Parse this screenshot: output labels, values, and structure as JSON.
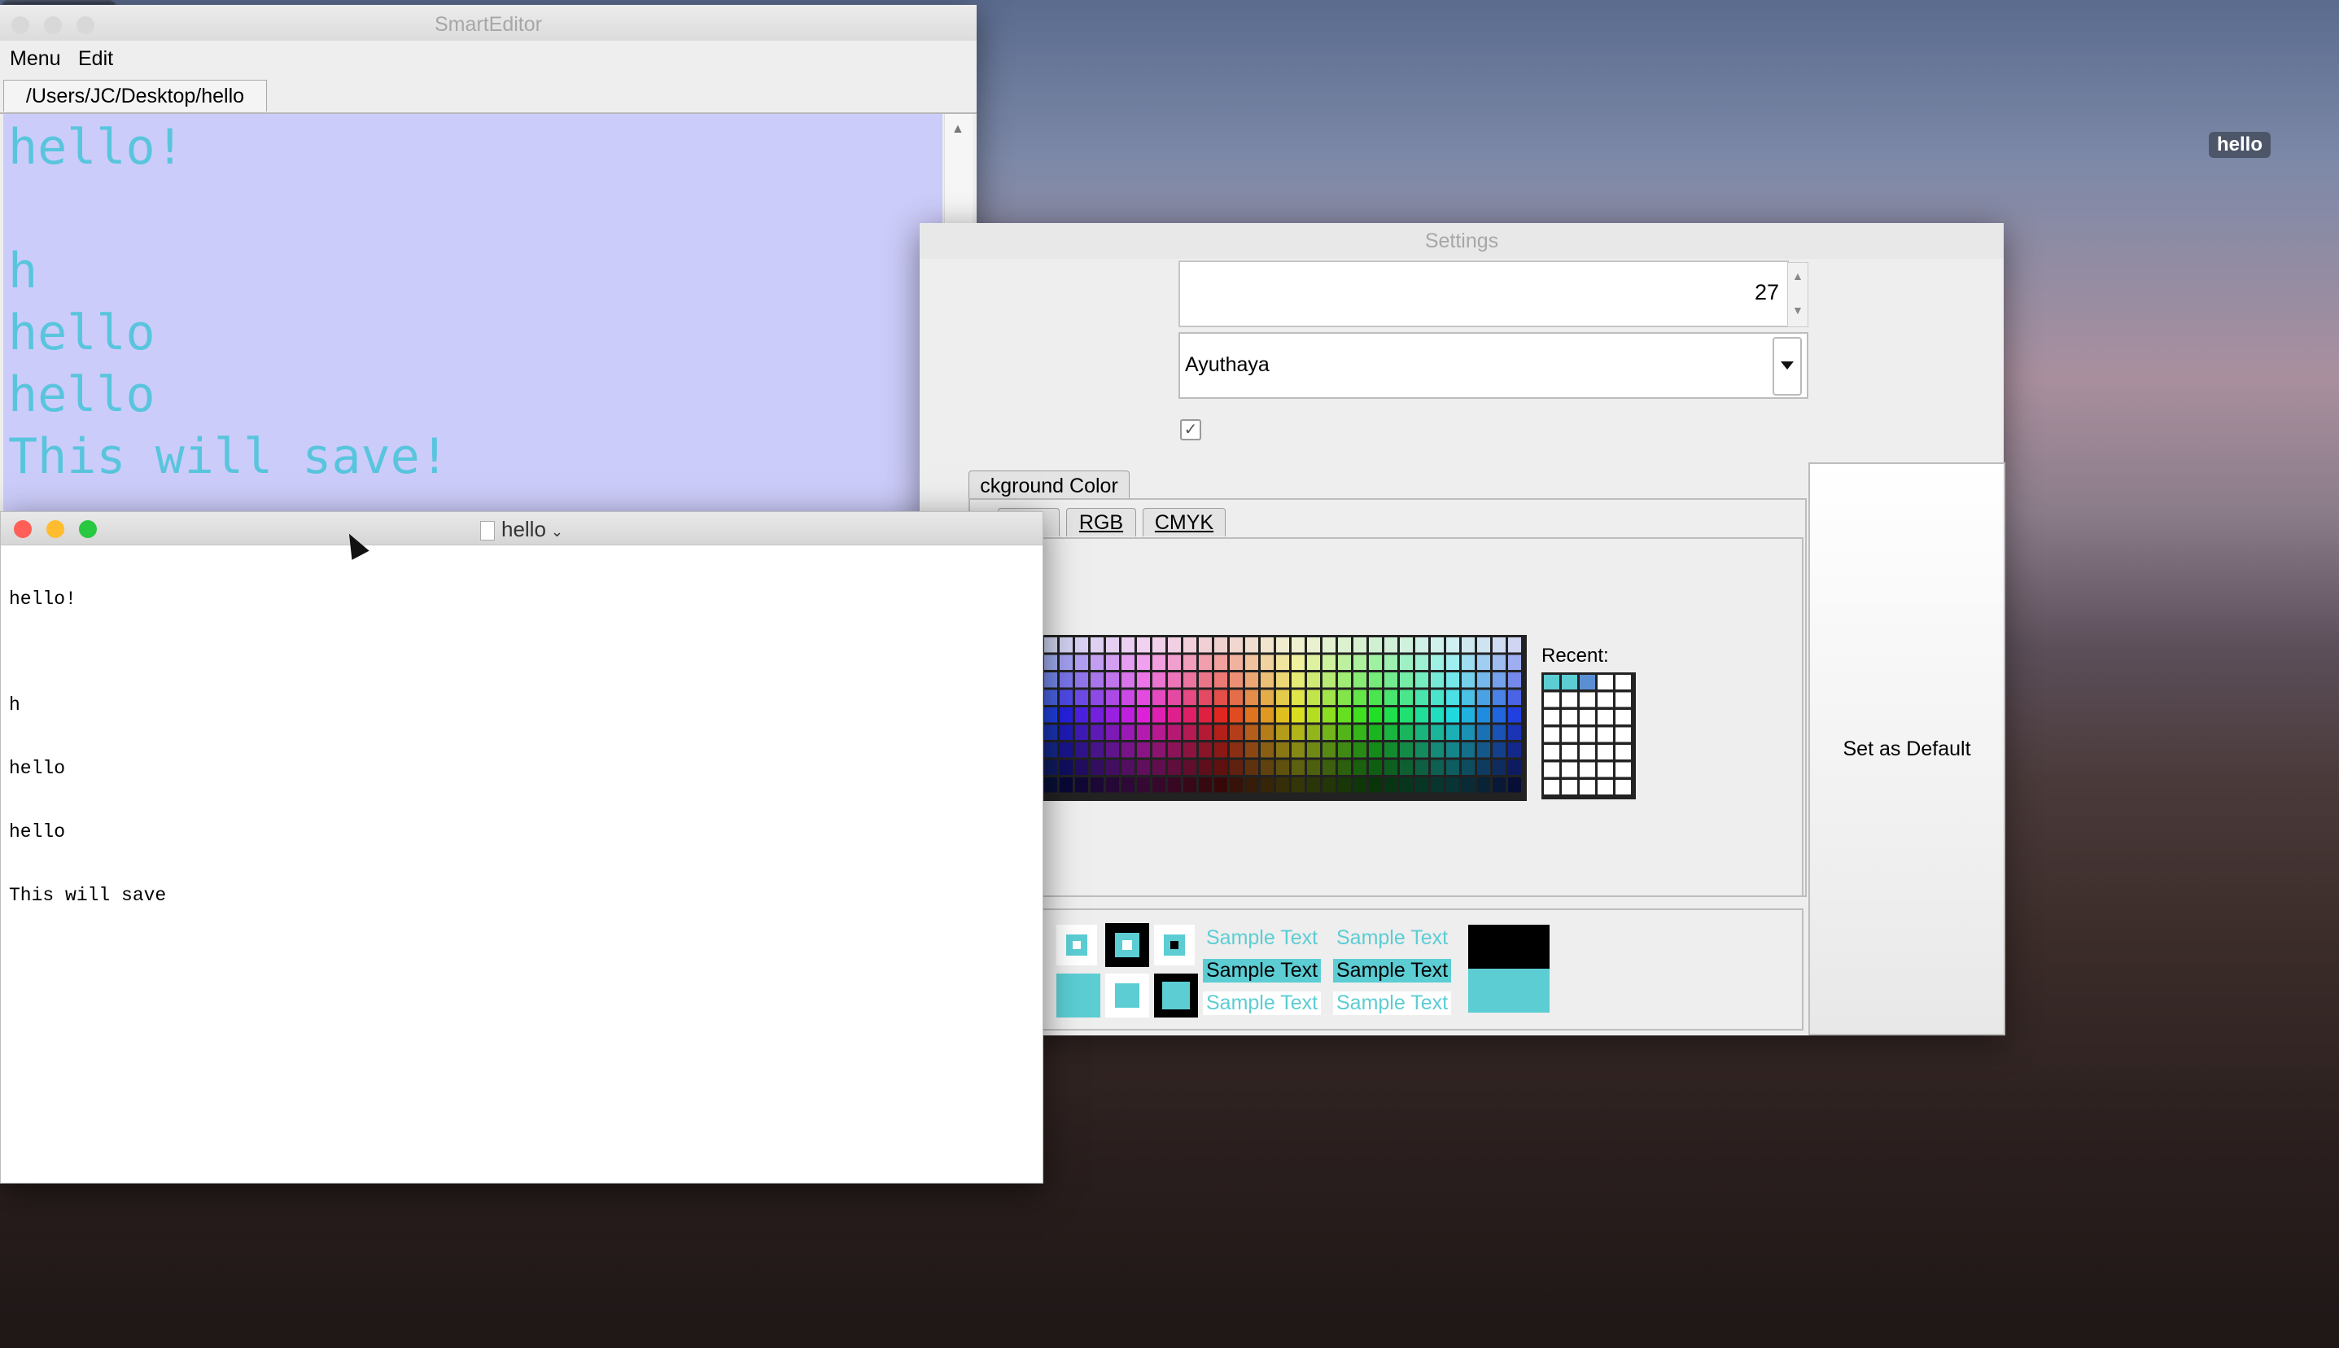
{
  "desktop": {
    "file_icon_label": "hello"
  },
  "smart_editor": {
    "window_title": "SmartEditor",
    "menus": [
      "Menu",
      "Edit"
    ],
    "tab_path": "/Users/JC/Desktop/hello",
    "lines": [
      "hello!",
      "",
      "h",
      "hello",
      "hello",
      "This will save!"
    ],
    "editor_background": "#ccccfa",
    "text_color": "#59c5dd"
  },
  "settings": {
    "window_title": "Settings",
    "font_size_value": "27",
    "font_family_value": "Ayuthaya",
    "checkbox_checked": true,
    "background_color_tab": "ckground Color",
    "color_chooser_tabs": [
      "L",
      "RGB",
      "CMYK"
    ],
    "recent_label": "Recent:",
    "set_default_label": "Set as Default",
    "sample_text": "Sample Text",
    "preview_colors": {
      "accent": "#5bcdd3",
      "dark": "#000000",
      "light": "#ffffff"
    }
  },
  "textedit": {
    "window_title": "hello",
    "lines": [
      "hello!",
      "",
      "h",
      "hello",
      "hello",
      "This will save"
    ]
  }
}
